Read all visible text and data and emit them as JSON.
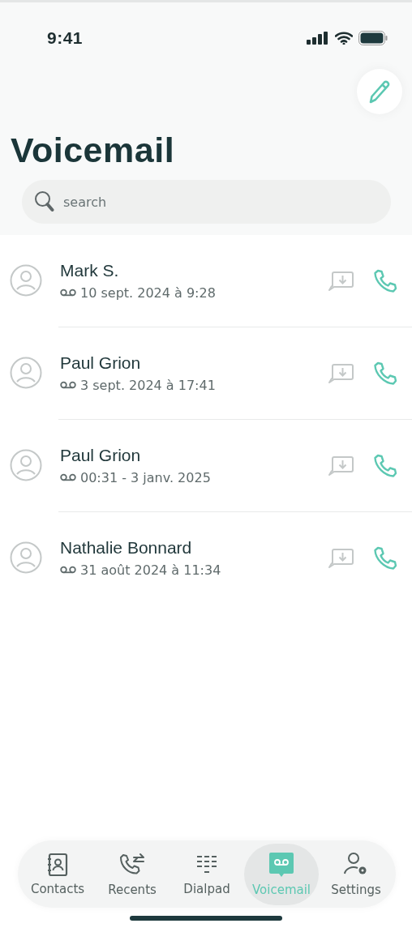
{
  "status_bar": {
    "time": "9:41"
  },
  "title": "Voicemail",
  "search": {
    "placeholder": "search"
  },
  "voicemails": [
    {
      "name": "Mark S.",
      "date": "10 sept. 2024 à 9:28"
    },
    {
      "name": "Paul Grion",
      "date": "3 sept. 2024 à 17:41"
    },
    {
      "name": "Paul Grion",
      "date": "00:31 - 3 janv. 2025"
    },
    {
      "name": "Nathalie Bonnard",
      "date": "31 août 2024 à 11:34"
    }
  ],
  "tabs": [
    {
      "label": "Contacts",
      "kind": "contacts",
      "selected": false
    },
    {
      "label": "Recents",
      "kind": "recents",
      "selected": false
    },
    {
      "label": "Dialpad",
      "kind": "dialpad",
      "selected": false
    },
    {
      "label": "Voicemail",
      "kind": "voicemail",
      "selected": true
    },
    {
      "label": "Settings",
      "kind": "settings",
      "selected": false
    }
  ]
}
